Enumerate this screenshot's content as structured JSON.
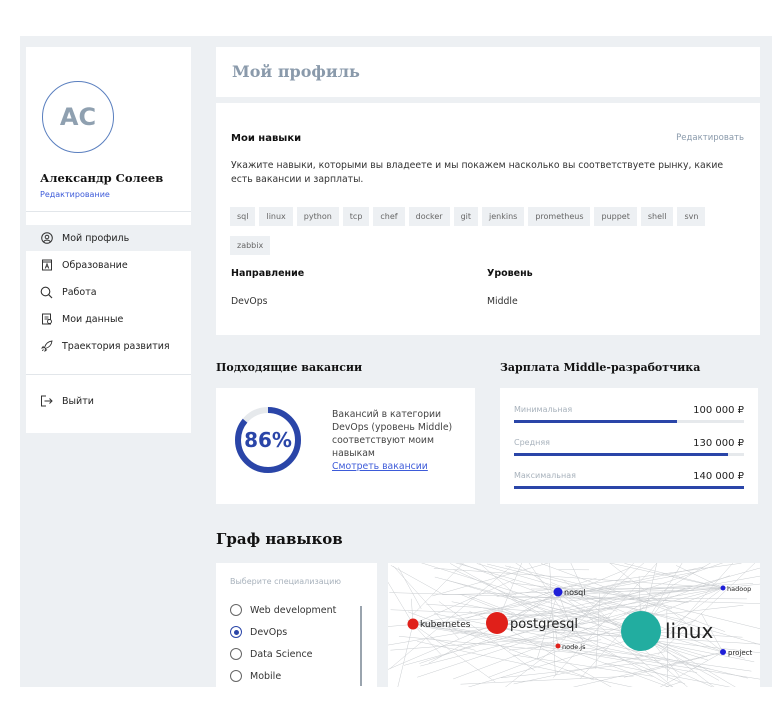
{
  "user": {
    "initials": "AC",
    "name": "Александр Солеев",
    "edit_label": "Редактирование"
  },
  "nav": [
    {
      "label": "Мой профиль",
      "icon": "user-circle-icon"
    },
    {
      "label": "Образование",
      "icon": "education-icon"
    },
    {
      "label": "Работа",
      "icon": "search-icon"
    },
    {
      "label": "Мои данные",
      "icon": "data-icon"
    },
    {
      "label": "Траектория развития",
      "icon": "rocket-icon"
    }
  ],
  "logout_label": "Выйти",
  "page_title": "Мой профиль",
  "skills": {
    "title": "Мои навыки",
    "edit_label": "Редактировать",
    "description": "Укажите навыки, которыми вы владеете и мы покажем насколько вы соответствуете рынку, какие есть вакансии и зарплаты.",
    "tags": [
      "sql",
      "linux",
      "python",
      "tcp",
      "chef",
      "docker",
      "git",
      "jenkins",
      "prometheus",
      "puppet",
      "shell",
      "svn",
      "zabbix"
    ]
  },
  "direction": {
    "label": "Направление",
    "value": "DevOps"
  },
  "level": {
    "label": "Уровень",
    "value": "Middle"
  },
  "vacancies": {
    "heading": "Подходящие вакансии",
    "percent_label": "86%",
    "percent": 86,
    "text": "Вакансий в категории DevOps (уровень Middle) соответствуют моим навыкам",
    "link": "Смотреть вакансии"
  },
  "salary": {
    "heading": "Зарплата Middle-разработчика",
    "rows": [
      {
        "label": "Минимальная",
        "value": "100 000 ₽",
        "fill": 0.71
      },
      {
        "label": "Средняя",
        "value": "130 000 ₽",
        "fill": 0.93
      },
      {
        "label": "Максимальная",
        "value": "140 000 ₽",
        "fill": 1.0
      }
    ]
  },
  "graph": {
    "heading": "Граф навыков",
    "prompt": "Выберите специализацию",
    "options": [
      {
        "label": "Web development",
        "checked": false
      },
      {
        "label": "DevOps",
        "checked": true
      },
      {
        "label": "Data Science",
        "checked": false
      },
      {
        "label": "Mobile",
        "checked": false
      }
    ],
    "nodes": [
      {
        "label": "nosql",
        "color": "#1f1fd8"
      },
      {
        "label": "hadoop",
        "color": "#1f1fd8"
      },
      {
        "label": "kubernetes",
        "color": "#e0201a"
      },
      {
        "label": "postgresql",
        "color": "#e0201a"
      },
      {
        "label": "linux",
        "color": "#22ada0"
      },
      {
        "label": "node.js",
        "color": "#e0201a"
      },
      {
        "label": "project",
        "color": "#1f1fd8"
      }
    ]
  }
}
